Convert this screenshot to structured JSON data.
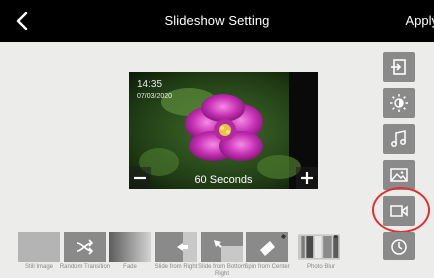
{
  "header": {
    "title": "Slideshow Setting",
    "apply_label": "Apply"
  },
  "preview": {
    "time": "14:35",
    "date": "07/03/2020",
    "duration": "60 Seconds"
  },
  "sidebar": {
    "buttons": [
      "exit-icon",
      "brightness-icon",
      "music-icon",
      "image-icon",
      "video-icon",
      "clock-icon"
    ]
  },
  "transitions": [
    {
      "label": "Still Image",
      "selected": false
    },
    {
      "label": "Random Transition",
      "selected": false
    },
    {
      "label": "Fade",
      "selected": false
    },
    {
      "label": "Slide from Right",
      "selected": false
    },
    {
      "label": "Slide from Bottom Right",
      "selected": false
    },
    {
      "label": "Spin from Center",
      "selected": false
    },
    {
      "label": "Photo Blur",
      "selected": true
    }
  ],
  "colors": {
    "highlight": "#e03030",
    "button_gray": "#8a8a8a"
  }
}
